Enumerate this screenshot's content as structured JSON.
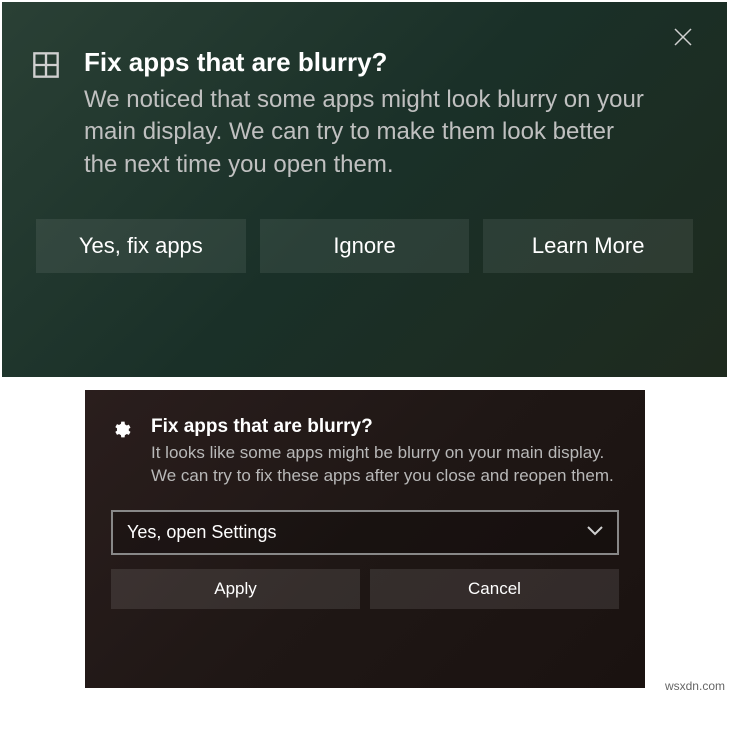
{
  "notification1": {
    "title": "Fix apps that are blurry?",
    "body": "We noticed that some apps might look blurry on your main display. We can try to make them look better the next time you open them.",
    "buttons": {
      "yes": "Yes, fix apps",
      "ignore": "Ignore",
      "learn": "Learn More"
    }
  },
  "notification2": {
    "title": "Fix apps that are blurry?",
    "body": "It looks like some apps might be blurry on your main display. We can try to fix these apps after you close and reopen them.",
    "dropdown": {
      "selected": "Yes, open Settings"
    },
    "buttons": {
      "apply": "Apply",
      "cancel": "Cancel"
    }
  },
  "watermark": "wsxdn.com"
}
